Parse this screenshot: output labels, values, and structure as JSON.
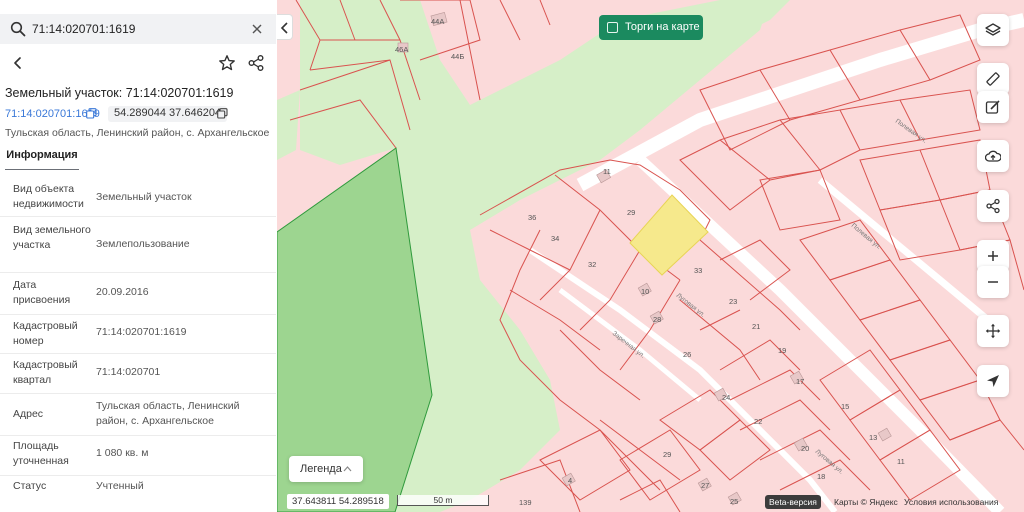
{
  "search": {
    "value": "71:14:020701:1619"
  },
  "parcel": {
    "title": "Земельный участок: 71:14:020701:1619",
    "cadastral_link": "71:14:020701:1619",
    "coords": "54.289044 37.646204",
    "address_line": "Тульская область, Ленинский район, с. Архангельское"
  },
  "tabs": {
    "info": "Информация"
  },
  "properties": [
    {
      "label": "Вид объекта недвижимости",
      "value": "Земельный участок"
    },
    {
      "label": "Вид земельного участка",
      "value": "Землепользование"
    },
    {
      "label": "Дата присвоения",
      "value": "20.09.2016"
    },
    {
      "label": "Кадастровый номер",
      "value": "71:14:020701:1619"
    },
    {
      "label": "Кадастровый квартал",
      "value": "71:14:020701"
    },
    {
      "label": "Адрес",
      "value": "Тульская область, Ленинский район, с. Архангельское"
    },
    {
      "label": "Площадь уточненная",
      "value": "1 080 кв. м"
    },
    {
      "label": "Статус",
      "value": "Учтенный"
    }
  ],
  "map": {
    "auction_toggle": "Торги на карте",
    "legend": "Легенда",
    "coord_readout": "37.643811  54.289518",
    "scale": "50 m",
    "beta": "Beta-версия",
    "attribution": "Карты © Яндекс",
    "terms": "Условия использования",
    "plot_labels": {
      "p44a": "44А",
      "p44b": "44Б",
      "p46a": "46А",
      "p11": "11",
      "p29": "29",
      "p36": "36",
      "p34": "34",
      "p32": "32",
      "p33": "33",
      "p10": "10",
      "p23": "23",
      "p28": "28",
      "p21": "21",
      "p26": "26",
      "p19": "19",
      "p17": "17",
      "p24": "24",
      "p15": "15",
      "p22": "22",
      "p13": "13",
      "p20": "20",
      "p11b": "11",
      "p29b": "29",
      "p18": "18",
      "p4": "4",
      "p27": "27",
      "p25": "25",
      "p139": "139"
    },
    "street_labels": {
      "s1": "Полевая ул.",
      "s2": "Полевая ул.",
      "s3": "Луговая ул.",
      "s4": "Заречная ул.",
      "s5": "Луговая ул."
    }
  },
  "colors": {
    "parcel_fill": "#fbdada",
    "parcel_border": "#d9534f",
    "forest": "#9dd590",
    "meadow": "#d6efc8",
    "selected_parcel": "#f6e98c",
    "accent_green": "#1b8a5f",
    "link_blue": "#3a78d8"
  },
  "icons": {
    "toolbar": [
      "layers-icon",
      "ruler-icon",
      "edit-icon",
      "upload-icon",
      "share-icon",
      "zoom-in-icon",
      "zoom-out-icon",
      "move-icon",
      "locate-icon"
    ]
  }
}
